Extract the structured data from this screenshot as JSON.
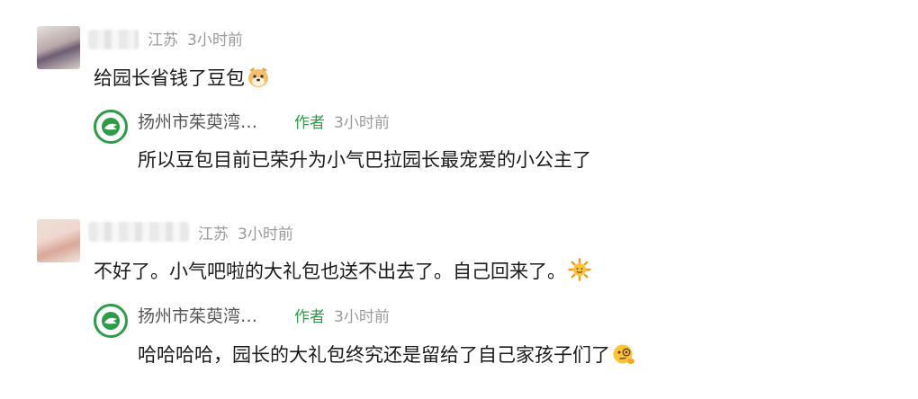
{
  "comments": [
    {
      "location": "江苏",
      "time": "3小时前",
      "text": "给园长省钱了豆包",
      "reply": {
        "name": "扬州市茱萸湾…",
        "tag": "作者",
        "time": "3小时前",
        "text": "所以豆包目前已荣升为小气巴拉园长最宠爱的小公主了"
      }
    },
    {
      "location": "江苏",
      "time": "3小时前",
      "text": "不好了。小气吧啦的大礼包也送不出去了。自己回来了。",
      "reply": {
        "name": "扬州市茱萸湾…",
        "tag": "作者",
        "time": "3小时前",
        "text": "哈哈哈哈，园长的大礼包终究还是留给了自己家孩子们了"
      }
    }
  ],
  "icons": {
    "c1_emoji": "dog-face-emoji-icon",
    "c2_emoji": "sun-emoji-icon",
    "r2_emoji": "monocle-face-emoji-icon"
  },
  "colors": {
    "accent": "#2e9b49",
    "meta": "#9a9a9a",
    "text": "#1a1a1a"
  }
}
